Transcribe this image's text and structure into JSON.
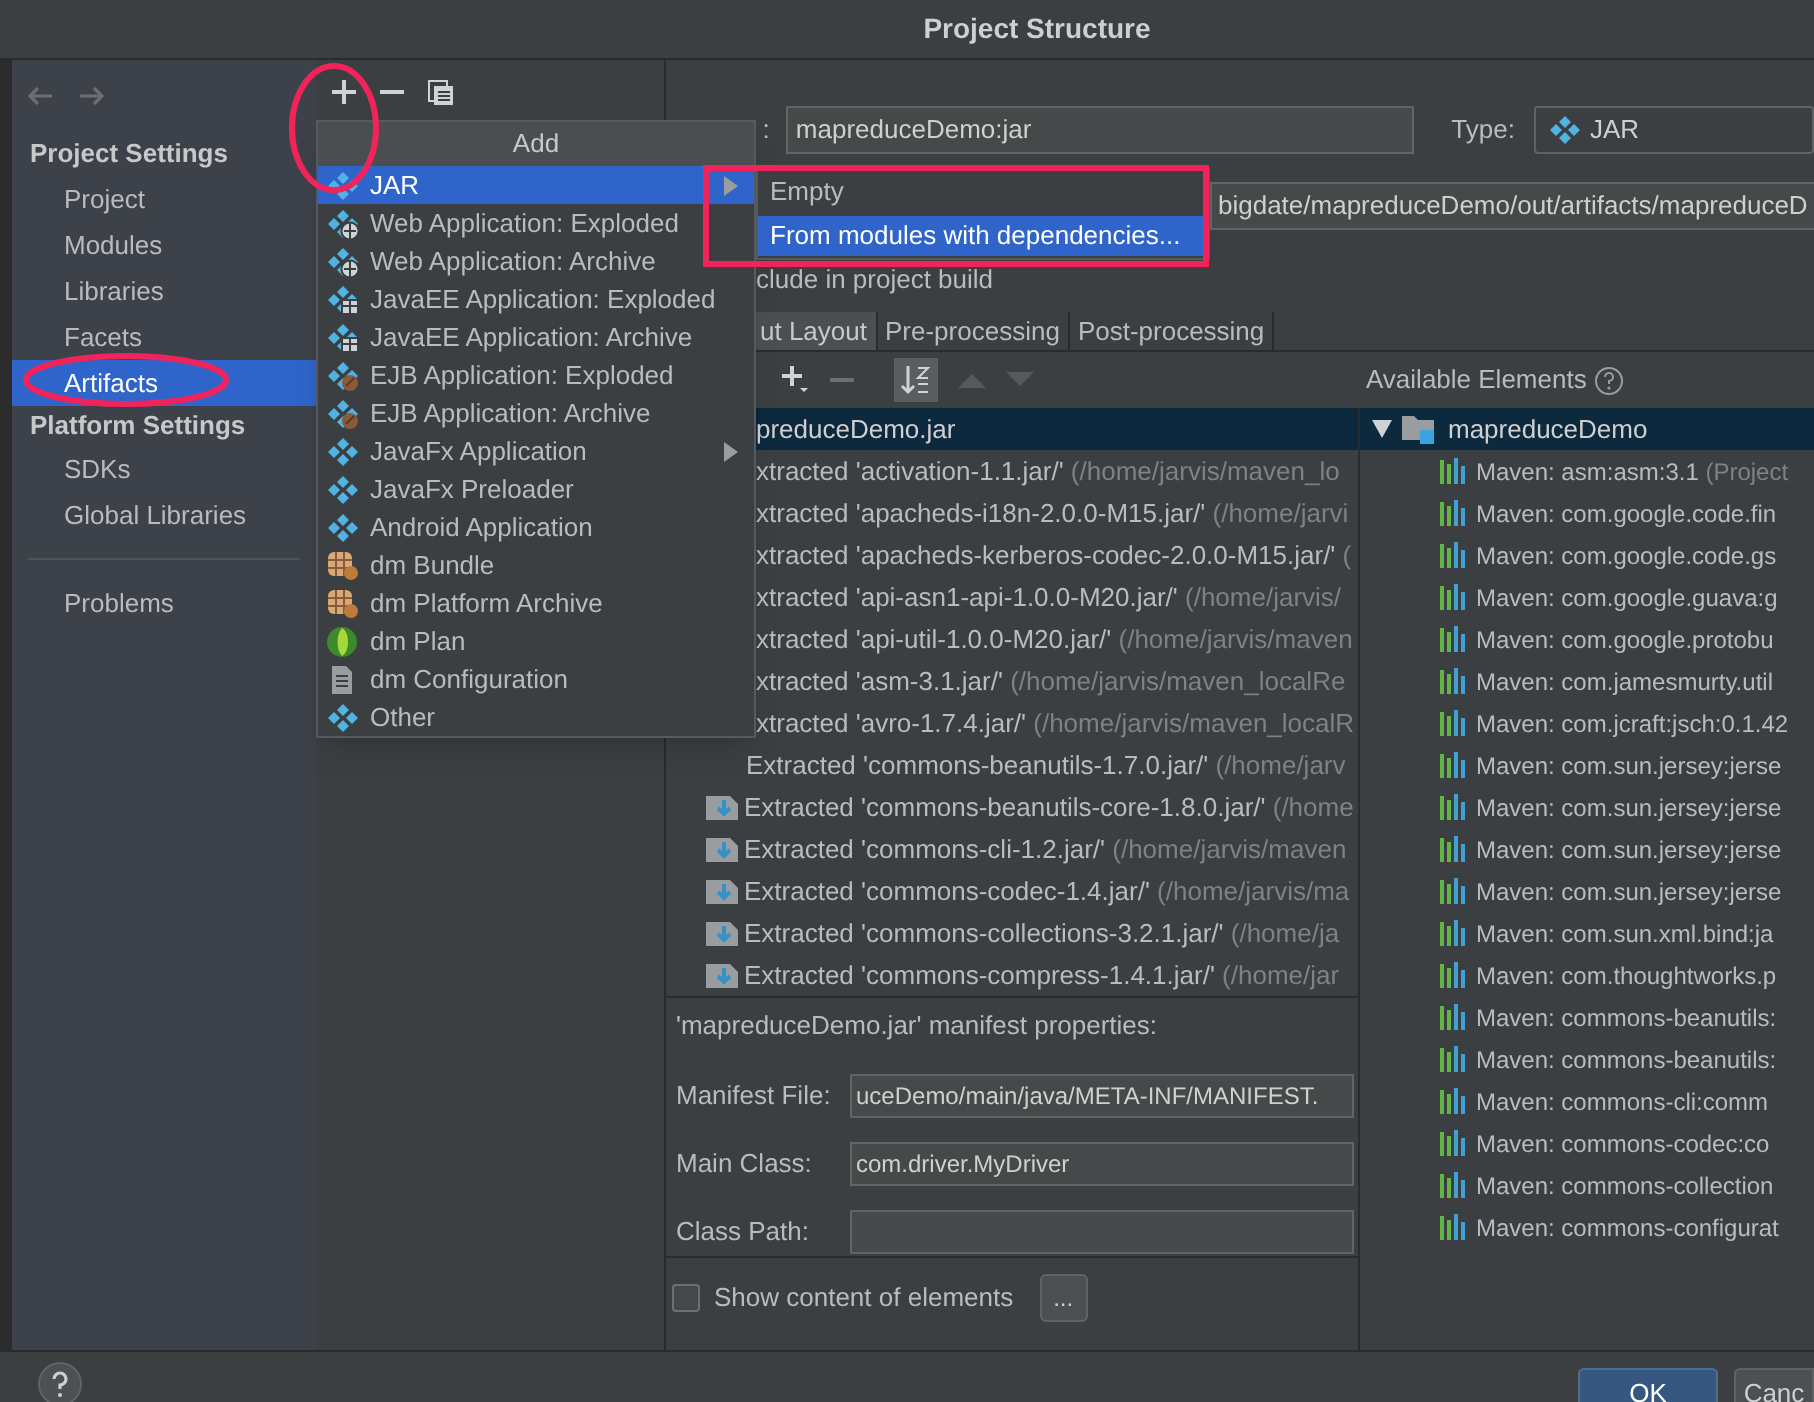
{
  "window": {
    "title": "Project Structure"
  },
  "sidebar": {
    "sections": [
      {
        "heading": "Project Settings",
        "items": [
          {
            "label": "Project",
            "selected": false
          },
          {
            "label": "Modules",
            "selected": false
          },
          {
            "label": "Libraries",
            "selected": false
          },
          {
            "label": "Facets",
            "selected": false
          },
          {
            "label": "Artifacts",
            "selected": true
          }
        ]
      },
      {
        "heading": "Platform Settings",
        "items": [
          {
            "label": "SDKs",
            "selected": false
          },
          {
            "label": "Global Libraries",
            "selected": false
          }
        ]
      }
    ],
    "footer_items": [
      {
        "label": "Problems",
        "selected": false
      }
    ]
  },
  "add_menu": {
    "title": "Add",
    "items": [
      {
        "label": "JAR",
        "kind": "jar",
        "has_submenu": true,
        "selected": true
      },
      {
        "label": "Web Application: Exploded",
        "kind": "web",
        "has_submenu": false,
        "selected": false
      },
      {
        "label": "Web Application: Archive",
        "kind": "web",
        "has_submenu": false,
        "selected": false
      },
      {
        "label": "JavaEE Application: Exploded",
        "kind": "javaee",
        "has_submenu": false,
        "selected": false
      },
      {
        "label": "JavaEE Application: Archive",
        "kind": "javaee",
        "has_submenu": false,
        "selected": false
      },
      {
        "label": "EJB Application: Exploded",
        "kind": "ejb",
        "has_submenu": false,
        "selected": false
      },
      {
        "label": "EJB Application: Archive",
        "kind": "ejb",
        "has_submenu": false,
        "selected": false
      },
      {
        "label": "JavaFx Application",
        "kind": "jar",
        "has_submenu": true,
        "selected": false
      },
      {
        "label": "JavaFx Preloader",
        "kind": "jar",
        "has_submenu": false,
        "selected": false
      },
      {
        "label": "Android Application",
        "kind": "jar",
        "has_submenu": false,
        "selected": false
      },
      {
        "label": "dm Bundle",
        "kind": "bundle",
        "has_submenu": false,
        "selected": false
      },
      {
        "label": "dm Platform Archive",
        "kind": "bundle",
        "has_submenu": false,
        "selected": false
      },
      {
        "label": "dm Plan",
        "kind": "plan",
        "has_submenu": false,
        "selected": false
      },
      {
        "label": "dm Configuration",
        "kind": "config",
        "has_submenu": false,
        "selected": false
      },
      {
        "label": "Other",
        "kind": "jar",
        "has_submenu": false,
        "selected": false
      }
    ]
  },
  "jar_submenu": {
    "items": [
      {
        "label": "Empty",
        "selected": false
      },
      {
        "label": "From modules with dependencies...",
        "selected": true
      }
    ]
  },
  "artifact": {
    "name_label": ":",
    "name": "mapreduceDemo:jar",
    "type_label": "Type:",
    "type": "JAR",
    "output_directory": "bigdate/mapreduceDemo/out/artifacts/mapreduceD",
    "include_label": "clude in project build"
  },
  "layout_tabs": [
    {
      "label": "ut Layout",
      "selected": true
    },
    {
      "label": "Pre-processing",
      "selected": false
    },
    {
      "label": "Post-processing",
      "selected": false
    }
  ],
  "output_layout": {
    "root": {
      "label": "preduceDemo.jar",
      "selected": true
    },
    "items": [
      {
        "kind": "partial",
        "name": "xtracted 'activation-1.1.jar/'",
        "path": "(/home/jarvis/maven_lo"
      },
      {
        "kind": "partial",
        "name": "xtracted 'apacheds-i18n-2.0.0-M15.jar/'",
        "path": "(/home/jarvi"
      },
      {
        "kind": "partial",
        "name": "xtracted 'apacheds-kerberos-codec-2.0.0-M15.jar/'",
        "path": "("
      },
      {
        "kind": "partial",
        "name": "xtracted 'api-asn1-api-1.0.0-M20.jar/'",
        "path": "(/home/jarvis/"
      },
      {
        "kind": "partial",
        "name": "xtracted 'api-util-1.0.0-M20.jar/'",
        "path": "(/home/jarvis/maven"
      },
      {
        "kind": "partial",
        "name": "xtracted 'asm-3.1.jar/'",
        "path": "(/home/jarvis/maven_localRe"
      },
      {
        "kind": "partial",
        "name": "xtracted 'avro-1.7.4.jar/'",
        "path": "(/home/jarvis/maven_localR"
      },
      {
        "kind": "covered_icon",
        "name": "Extracted 'commons-beanutils-1.7.0.jar/'",
        "path": "(/home/jarv"
      },
      {
        "kind": "full",
        "name": "Extracted 'commons-beanutils-core-1.8.0.jar/'",
        "path": "(/home"
      },
      {
        "kind": "full",
        "name": "Extracted 'commons-cli-1.2.jar/'",
        "path": "(/home/jarvis/maven"
      },
      {
        "kind": "full",
        "name": "Extracted 'commons-codec-1.4.jar/'",
        "path": "(/home/jarvis/ma"
      },
      {
        "kind": "full",
        "name": "Extracted 'commons-collections-3.2.1.jar/'",
        "path": "(/home/ja"
      },
      {
        "kind": "full",
        "name": "Extracted 'commons-compress-1.4.1.jar/'",
        "path": "(/home/jar"
      }
    ]
  },
  "available_elements": {
    "label": "Available Elements",
    "root": {
      "label": "mapreduceDemo",
      "expanded": true,
      "selected": true,
      "children": [
        {
          "name": "Maven: asm:asm:3.1",
          "note": "(Project"
        },
        {
          "name": "Maven: com.google.code.fin"
        },
        {
          "name": "Maven: com.google.code.gs"
        },
        {
          "name": "Maven: com.google.guava:g"
        },
        {
          "name": "Maven: com.google.protobu"
        },
        {
          "name": "Maven: com.jamesmurty.util"
        },
        {
          "name": "Maven: com.jcraft:jsch:0.1.42"
        },
        {
          "name": "Maven: com.sun.jersey:jerse"
        },
        {
          "name": "Maven: com.sun.jersey:jerse"
        },
        {
          "name": "Maven: com.sun.jersey:jerse"
        },
        {
          "name": "Maven: com.sun.jersey:jerse"
        },
        {
          "name": "Maven: com.sun.xml.bind:ja"
        },
        {
          "name": "Maven: com.thoughtworks.p"
        },
        {
          "name": "Maven: commons-beanutils:"
        },
        {
          "name": "Maven: commons-beanutils:"
        },
        {
          "name": "Maven: commons-cli:comm"
        },
        {
          "name": "Maven: commons-codec:co"
        },
        {
          "name": "Maven: commons-collection"
        },
        {
          "name": "Maven: commons-configurat"
        }
      ]
    }
  },
  "manifest": {
    "title": "'mapreduceDemo.jar' manifest properties:",
    "fields": [
      {
        "label": "Manifest File:",
        "value": "uceDemo/main/java/META-INF/MANIFEST."
      },
      {
        "label": "Main Class:",
        "value": "com.driver.MyDriver"
      },
      {
        "label": "Class Path:"
      }
    ]
  },
  "show_content": {
    "label": "Show content of elements",
    "checked": false
  },
  "browse_button": "...",
  "footer": {
    "buttons": [
      {
        "label": "OK",
        "kind": "default"
      },
      {
        "label": "Canc",
        "kind": "normal"
      }
    ]
  }
}
